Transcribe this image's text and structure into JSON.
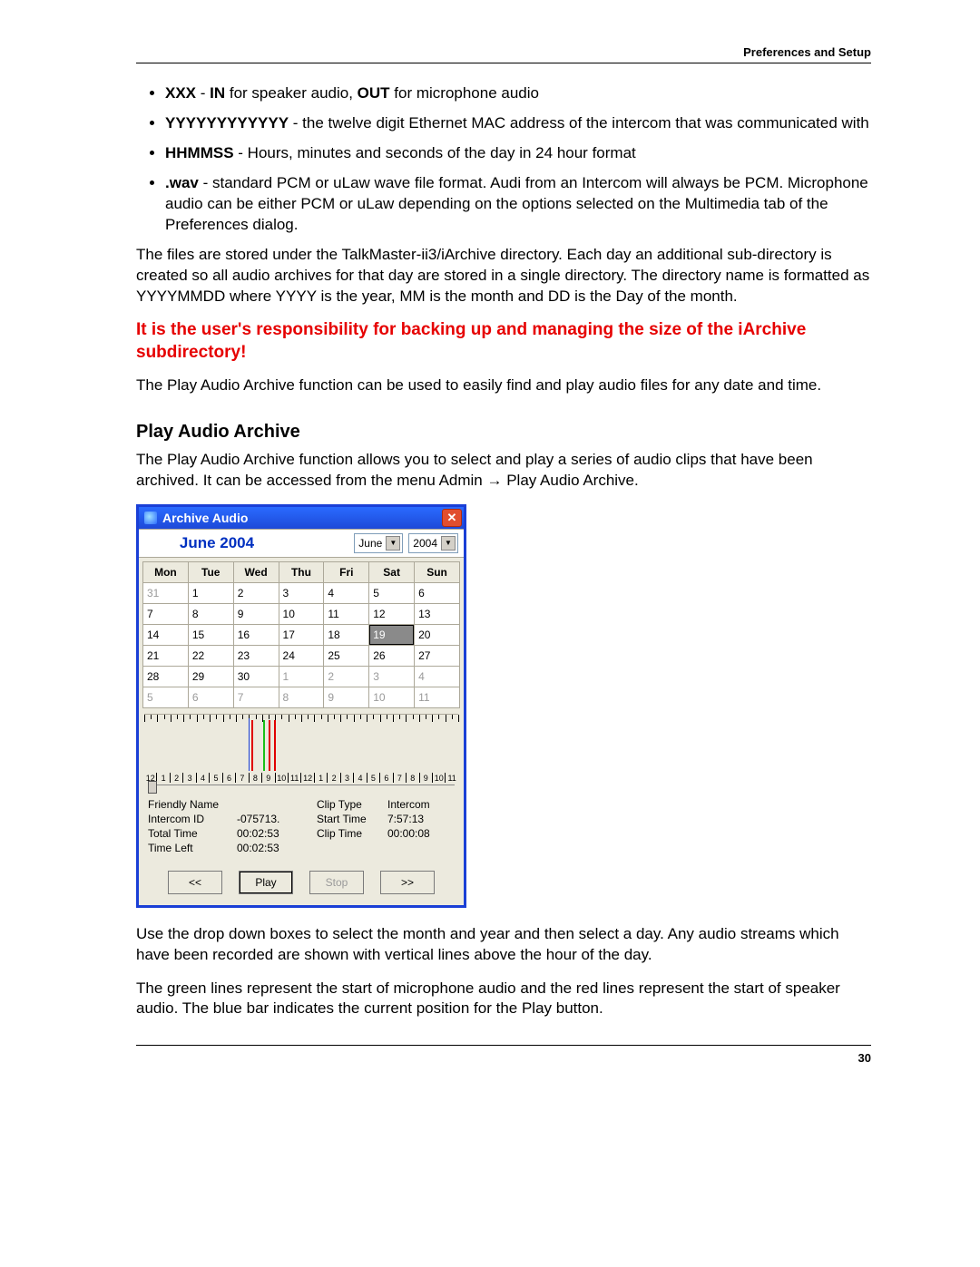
{
  "header": {
    "right": "Preferences and Setup"
  },
  "footer": {
    "page": "30"
  },
  "bullets": [
    {
      "boldA": "XXX",
      "midA": " - ",
      "boldB": "IN",
      "midB": " for speaker audio, ",
      "boldC": "OUT",
      "tail": " for microphone audio"
    },
    {
      "boldA": "YYYYYYYYYYYY",
      "tail": " - the twelve digit Ethernet MAC address of the intercom that was communicated with"
    },
    {
      "boldA": "HHMMSS",
      "tail": " - Hours, minutes and seconds of the day in 24 hour format"
    },
    {
      "boldA": ".wav",
      "tail": " - standard PCM or uLaw wave file format. Audi from an Intercom will always be PCM. Microphone audio can be either PCM or uLaw depending on the options selected on the Multimedia tab of the Preferences dialog."
    }
  ],
  "para1": "The files are stored under the TalkMaster-ii3/iArchive directory.  Each day an additional sub-directory is created so all audio archives for that day are stored in a single directory.  The directory name is formatted as YYYYMMDD where YYYY is the year, MM is the month and DD is the Day of the month.",
  "warning": "It is the user's responsibility for backing up and managing the size of the iArchive subdirectory!",
  "para2": "The Play Audio Archive function can be used to easily find and play audio files for any date and time.",
  "section_title": "Play Audio Archive",
  "para3": "The Play Audio Archive function allows you to select and play a series of audio clips that have been archived. It can be accessed from the menu Admin → Play Audio Archive.",
  "para4": "Use the drop down boxes to select the month and year and then select a day.  Any audio streams which have been recorded are shown with vertical lines above the hour of the day.",
  "para5": "The green lines represent the start of microphone audio and the red lines represent the start of speaker audio.  The blue bar indicates the current position for the Play button.",
  "win": {
    "title": "Archive Audio",
    "big_month": "June 2004",
    "month_select": "June",
    "year_select": "2004",
    "weekdays": [
      "Mon",
      "Tue",
      "Wed",
      "Thu",
      "Fri",
      "Sat",
      "Sun"
    ],
    "rows": [
      [
        {
          "d": "31",
          "out": true
        },
        {
          "d": "1"
        },
        {
          "d": "2"
        },
        {
          "d": "3"
        },
        {
          "d": "4"
        },
        {
          "d": "5"
        },
        {
          "d": "6"
        }
      ],
      [
        {
          "d": "7"
        },
        {
          "d": "8"
        },
        {
          "d": "9"
        },
        {
          "d": "10"
        },
        {
          "d": "11"
        },
        {
          "d": "12"
        },
        {
          "d": "13"
        }
      ],
      [
        {
          "d": "14"
        },
        {
          "d": "15"
        },
        {
          "d": "16"
        },
        {
          "d": "17"
        },
        {
          "d": "18"
        },
        {
          "d": "19",
          "sel": true
        },
        {
          "d": "20"
        }
      ],
      [
        {
          "d": "21"
        },
        {
          "d": "22"
        },
        {
          "d": "23"
        },
        {
          "d": "24"
        },
        {
          "d": "25"
        },
        {
          "d": "26"
        },
        {
          "d": "27"
        }
      ],
      [
        {
          "d": "28"
        },
        {
          "d": "29"
        },
        {
          "d": "30"
        },
        {
          "d": "1",
          "out": true
        },
        {
          "d": "2",
          "out": true
        },
        {
          "d": "3",
          "out": true
        },
        {
          "d": "4",
          "out": true
        }
      ],
      [
        {
          "d": "5",
          "out": true
        },
        {
          "d": "6",
          "out": true
        },
        {
          "d": "7",
          "out": true
        },
        {
          "d": "8",
          "out": true
        },
        {
          "d": "9",
          "out": true
        },
        {
          "d": "10",
          "out": true
        },
        {
          "d": "11",
          "out": true
        }
      ]
    ],
    "hours": [
      "12",
      "1",
      "2",
      "3",
      "4",
      "5",
      "6",
      "7",
      "8",
      "9",
      "10",
      "11",
      "12",
      "1",
      "2",
      "3",
      "4",
      "5",
      "6",
      "7",
      "8",
      "9",
      "10",
      "11"
    ],
    "labels": {
      "friendly_name": "Friendly Name",
      "intercom_id": "Intercom ID",
      "total_time": "Total Time",
      "time_left": "Time Left",
      "clip_type": "Clip Type",
      "start_time": "Start Time",
      "clip_time": "Clip Time"
    },
    "values": {
      "friendly_name": "",
      "intercom_id": "-075713.",
      "total_time": "00:02:53",
      "time_left": "00:02:53",
      "clip_type": "Intercom",
      "start_time": "7:57:13",
      "clip_time": "00:00:08"
    },
    "buttons": {
      "prev": "<<",
      "play": "Play",
      "stop": "Stop",
      "next": ">>"
    },
    "marks": [
      {
        "type": "blue",
        "pct": 33.2
      },
      {
        "type": "red",
        "pct": 34.0
      },
      {
        "type": "green",
        "pct": 37.8
      },
      {
        "type": "red",
        "pct": 39.6
      },
      {
        "type": "red",
        "pct": 41.4
      }
    ]
  }
}
